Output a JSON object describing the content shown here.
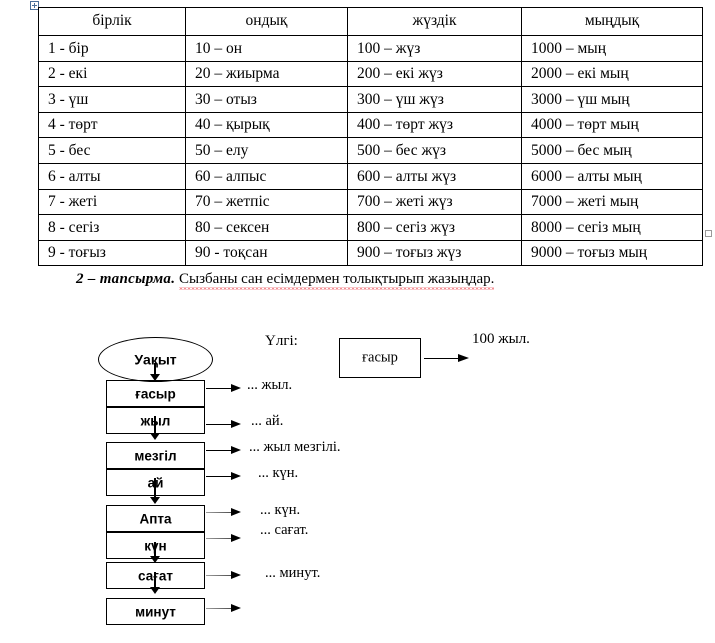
{
  "document": {
    "table": {
      "headers": [
        "бірлік",
        "ондық",
        "жүздік",
        "мыңдық"
      ],
      "rows": [
        [
          "1 - бір",
          "10 – он",
          "100 – жүз",
          "1000 – мың"
        ],
        [
          "2 - екі",
          "20 – жиырма",
          "200 – екі жүз",
          "2000 – екі мың"
        ],
        [
          "3 - үш",
          "30 – отыз",
          "300 – үш жүз",
          "3000 – үш мың"
        ],
        [
          "4 - төрт",
          "40 – қырық",
          "400 – төрт жүз",
          "4000 – төрт мың"
        ],
        [
          "5 - бес",
          "50 – елу",
          "500 – бес жүз",
          "5000 – бес мың"
        ],
        [
          "6 - алты",
          "60 – алпыс",
          "600 – алты жүз",
          "6000 – алты мың"
        ],
        [
          "7 - жеті",
          "70 – жетпіс",
          "700 – жеті жүз",
          "7000 – жеті мың"
        ],
        [
          "8 - сегіз",
          "80 – сексен",
          "800 – сегіз жүз",
          "8000 – сегіз мың"
        ],
        [
          "9 - тоғыз",
          "90 - тоқсан",
          "900 – тоғыз жүз",
          "9000 – тоғыз мың"
        ]
      ]
    },
    "task": {
      "label": "2 – тапсырма.",
      "instruction": "Сызбаны сан есімдермен толықтырып жазыңдар."
    },
    "diagram": {
      "root": "Уақыт",
      "boxes": [
        "ғасыр",
        "жыл",
        "мезгіл",
        "ай",
        "Апта",
        "күн",
        "сағат",
        "минут"
      ],
      "labels": [
        "... жыл.",
        "... ай.",
        "... жыл мезгілі.",
        "... күн.",
        "... күн.",
        "... сағат.",
        "... минут."
      ],
      "sample": {
        "label": "Үлгі:",
        "box": "ғасыр",
        "result": "100 жыл."
      }
    }
  },
  "colors": {
    "ink": "#000000",
    "spellcheck": "#e8202a",
    "handle_border": "#4a6f9a",
    "arrow_gray": "#6e6e6e"
  }
}
